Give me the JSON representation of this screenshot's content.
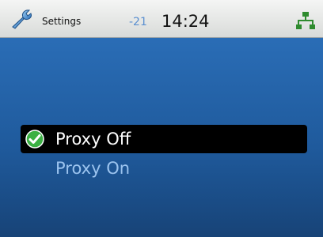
{
  "status_bar": {
    "app_title": "Settings",
    "signal": "-21",
    "time": "14:24",
    "left_icon": "wrench-icon",
    "right_icon": "network-icon"
  },
  "menu": {
    "items": [
      {
        "label": "Proxy Off",
        "selected": true,
        "icon": "check-icon"
      },
      {
        "label": "Proxy On",
        "selected": false
      }
    ]
  },
  "colors": {
    "screen_top": "#2a6db6",
    "screen_bottom": "#174377",
    "selection_bg": "#000000",
    "selected_text": "#ffffff",
    "unselected_text": "#9cc4ef",
    "check_green": "#3cb043",
    "network_green": "#2e8b2e",
    "signal_blue": "#5a8fd0"
  }
}
